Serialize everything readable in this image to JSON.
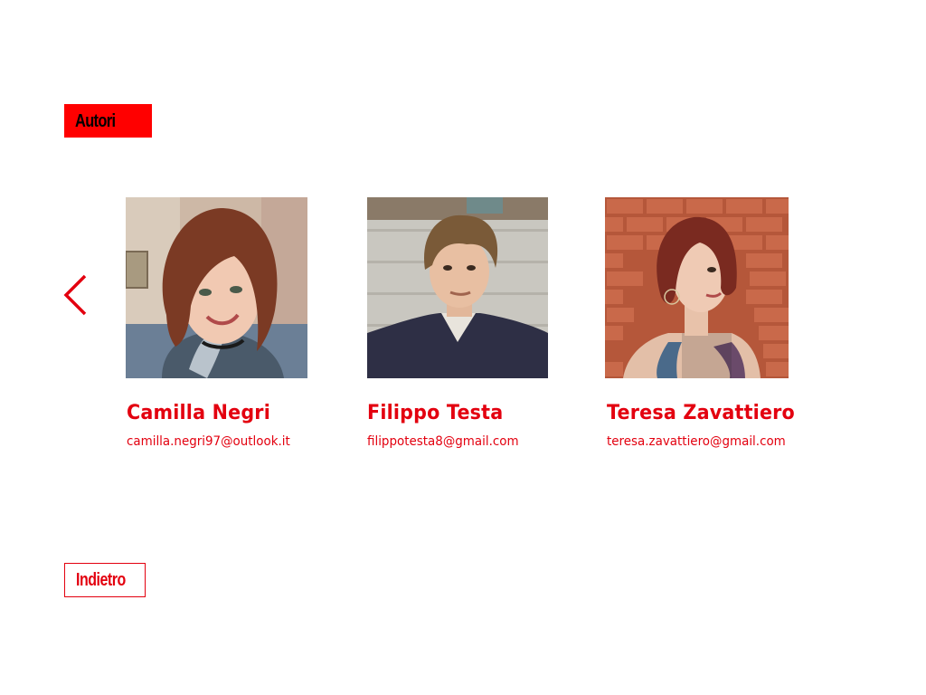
{
  "header": {
    "section_label": "Autori"
  },
  "carousel": {
    "prev_icon": "chevron-left-icon",
    "authors": [
      {
        "name": "Camilla Negri",
        "email": "camilla.negri97@outlook.it",
        "photo_alt": "Camilla Negri"
      },
      {
        "name": "Filippo Testa",
        "email": "filippotesta8@gmail.com",
        "photo_alt": "Filippo Testa"
      },
      {
        "name": "Teresa Zavattiero",
        "email": "teresa.zavattiero@gmail.com",
        "photo_alt": "Teresa Zavattiero"
      }
    ]
  },
  "footer": {
    "back_label": "Indietro"
  },
  "colors": {
    "accent": "#e3000f",
    "tag_background": "#ff0000",
    "background": "#ffffff"
  }
}
